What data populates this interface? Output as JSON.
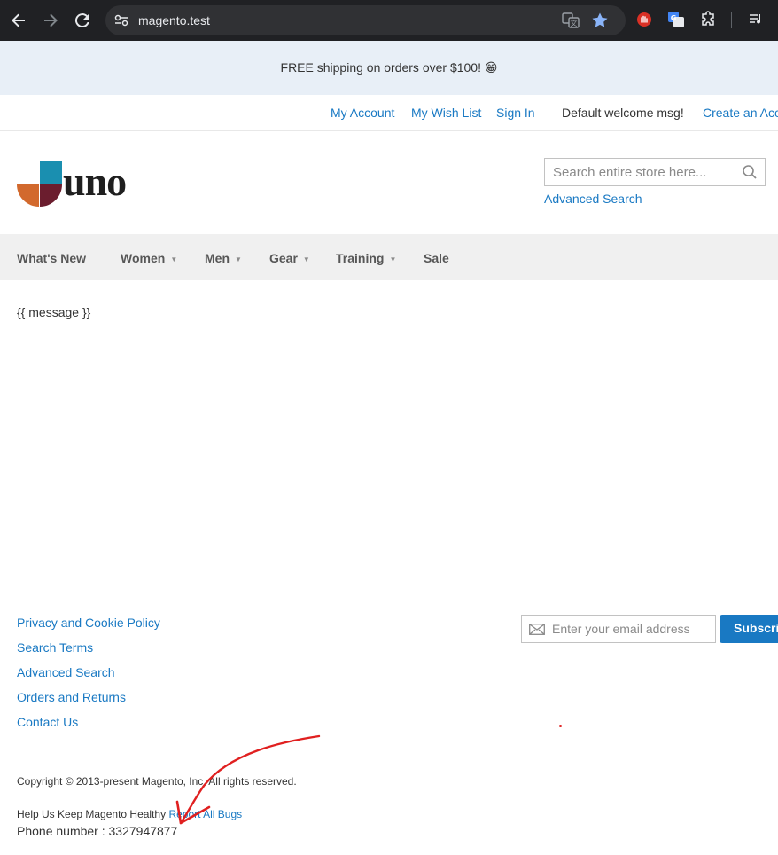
{
  "browser": {
    "url": "magento.test"
  },
  "promo": {
    "text": "FREE shipping on orders over $100! 😁"
  },
  "header_links": {
    "my_account": "My Account",
    "my_wish_list": "My Wish List",
    "sign_in": "Sign In",
    "welcome": "Default welcome msg!",
    "create_account": "Create an Account"
  },
  "logo": {
    "text": "uno",
    "colors": [
      "#1a8fb0",
      "#d2692d",
      "#6b1d2e"
    ]
  },
  "search": {
    "placeholder": "Search entire store here...",
    "advanced": "Advanced Search"
  },
  "nav": {
    "items": [
      {
        "label": "What's New",
        "has_dropdown": false
      },
      {
        "label": "Women",
        "has_dropdown": true
      },
      {
        "label": "Men",
        "has_dropdown": true
      },
      {
        "label": "Gear",
        "has_dropdown": true
      },
      {
        "label": "Training",
        "has_dropdown": true
      },
      {
        "label": "Sale",
        "has_dropdown": false
      }
    ]
  },
  "content": {
    "message": "{{ message }}"
  },
  "footer": {
    "links": [
      "Privacy and Cookie Policy",
      "Search Terms",
      "Advanced Search",
      "Orders and Returns",
      "Contact Us"
    ],
    "newsletter_placeholder": "Enter your email address",
    "subscribe": "Subscribe",
    "copyright": "Copyright © 2013-present Magento, Inc. All rights reserved.",
    "help_text": "Help Us Keep Magento Healthy",
    "help_link": "Report All Bugs",
    "phone": "Phone number : 3327947877"
  },
  "colors": {
    "link": "#1979c3",
    "promo_bg": "#e8eff7",
    "nav_bg": "#f0f0f0",
    "annotation": "#e02020"
  }
}
